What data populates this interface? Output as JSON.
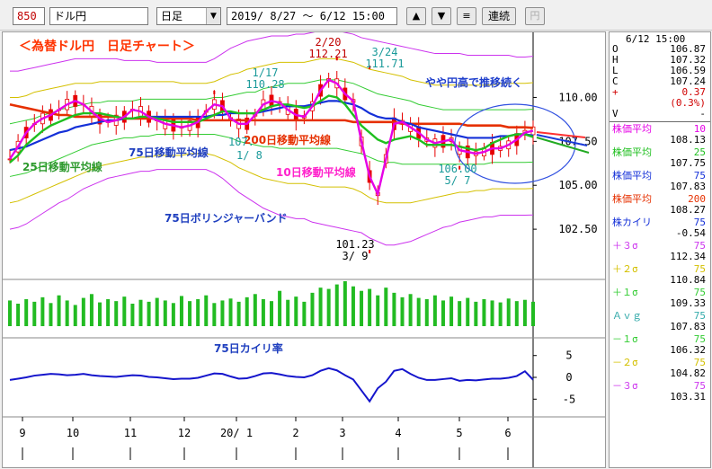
{
  "toolbar": {
    "code": "850",
    "name": "ドル円",
    "period": "日足",
    "period_dropdown_glyph": "▼",
    "range": "2019/ 8/27 ～  6/12 15:00",
    "btn_up": "▲",
    "btn_down": "▼",
    "btn_menu": "≡",
    "btn_link": "連続",
    "btn_yen": "円"
  },
  "chart": {
    "title": "＜為替ドル円　日足チャート＞",
    "annotations": {
      "ma25": "25日移動平均線",
      "ma75": "75日移動平均線",
      "ma200": "200日移動平均線",
      "ma10": "10日移動平均線",
      "bollinger": "75日ボリンジャーバンド",
      "deviation": "75日カイリ率",
      "note": "やや円高で推移続く"
    },
    "peaks": {
      "a_date": "1/17",
      "a_value": "110.28",
      "b_date": "2/20",
      "b_value": "112.21",
      "c_date": "3/24",
      "c_value": "111.71",
      "d_value": "106.00",
      "d_date": "5/ 7",
      "e_value": "101.23",
      "e_date": "3/ 9",
      "f_value": "107.",
      "f_date": "1/ 8"
    },
    "colors": {
      "candle": "#e60000",
      "ma10": "#e600e6",
      "ma25": "#1fbf1f",
      "ma75": "#1430d8",
      "ma200": "#e63000",
      "bb3": "#cc33ee",
      "bb2": "#d4c000",
      "bb1": "#33cc33",
      "volume": "#22bb22",
      "deviation": "#1515cc",
      "title": "#ff3300",
      "label_green": "#2e9a2e",
      "label_blue": "#1f3fbf",
      "label_pink": "#ff22cc",
      "label_note": "#1f3fcc"
    }
  },
  "chart_data": {
    "type": "line",
    "x_labels": [
      "9",
      "10",
      "11",
      "12",
      "20/ 1",
      "2",
      "3",
      "4",
      "5",
      "6"
    ],
    "price_axis": {
      "ticks": [
        "110.00",
        "107.50",
        "105.00",
        "102.50"
      ],
      "range": [
        100.0,
        113.5
      ]
    },
    "series": [
      {
        "name": "株価平均 10",
        "values": [
          106.5,
          107.2,
          108.0,
          108.5,
          108.8,
          109.0,
          109.3,
          109.6,
          109.8,
          109.6,
          109.2,
          108.8,
          108.6,
          108.7,
          108.9,
          109.3,
          109.2,
          108.9,
          108.7,
          108.5,
          108.4,
          108.3,
          108.4,
          108.6,
          109.2,
          109.6,
          109.5,
          108.8,
          108.5,
          108.5,
          109.0,
          109.6,
          109.8,
          109.7,
          109.3,
          109.0,
          108.9,
          109.5,
          110.4,
          111.0,
          110.8,
          110.2,
          109.8,
          107.5,
          105.5,
          104.5,
          106.5,
          108.5,
          108.6,
          108.3,
          108.0,
          107.6,
          107.4,
          107.5,
          107.6,
          107.0,
          106.9,
          106.8,
          106.9,
          107.1,
          107.1,
          107.3,
          107.6,
          108.0,
          108.1
        ]
      },
      {
        "name": "株価平均 25",
        "values": [
          106.3,
          106.7,
          107.3,
          107.7,
          108.1,
          108.4,
          108.6,
          108.8,
          109.0,
          109.1,
          109.1,
          109.1,
          109.0,
          108.9,
          108.8,
          108.8,
          108.9,
          108.9,
          108.8,
          108.7,
          108.6,
          108.6,
          108.6,
          108.6,
          108.8,
          109.0,
          109.2,
          109.2,
          109.1,
          109.1,
          109.1,
          109.3,
          109.5,
          109.6,
          109.6,
          109.5,
          109.4,
          109.5,
          109.8,
          110.1,
          110.0,
          109.6,
          109.0,
          108.4,
          108.0,
          107.6,
          107.4,
          107.6,
          107.7,
          107.8,
          107.6,
          107.3,
          107.3,
          107.3,
          107.3,
          107.2,
          107.1,
          107.0,
          107.1,
          107.4,
          107.6,
          107.8,
          107.9,
          107.9,
          107.75
        ]
      },
      {
        "name": "株価平均 75",
        "values": [
          107.0,
          107.1,
          107.2,
          107.4,
          107.6,
          107.8,
          108.0,
          108.1,
          108.3,
          108.4,
          108.5,
          108.6,
          108.7,
          108.7,
          108.8,
          108.8,
          108.9,
          108.9,
          108.9,
          108.9,
          108.9,
          108.9,
          108.9,
          108.9,
          108.9,
          109.0,
          109.0,
          109.1,
          109.1,
          109.1,
          109.1,
          109.2,
          109.3,
          109.4,
          109.5,
          109.5,
          109.5,
          109.6,
          109.7,
          109.8,
          109.8,
          109.7,
          109.6,
          109.4,
          109.1,
          108.9,
          108.8,
          108.8,
          108.6,
          108.5,
          108.3,
          108.2,
          108.1,
          108.0,
          107.9,
          107.8,
          107.7,
          107.7,
          107.7,
          107.7,
          107.8,
          107.8,
          107.9,
          107.9,
          107.83
        ]
      },
      {
        "name": "株価平均 200",
        "values": [
          109.6,
          109.5,
          109.4,
          109.3,
          109.2,
          109.1,
          109.0,
          109.0,
          108.9,
          108.9,
          108.9,
          108.9,
          108.9,
          108.9,
          108.8,
          108.8,
          108.8,
          108.8,
          108.8,
          108.8,
          108.8,
          108.8,
          108.8,
          108.7,
          108.7,
          108.7,
          108.7,
          108.7,
          108.7,
          108.7,
          108.7,
          108.7,
          108.7,
          108.7,
          108.7,
          108.7,
          108.7,
          108.7,
          108.7,
          108.7,
          108.7,
          108.7,
          108.6,
          108.6,
          108.6,
          108.6,
          108.6,
          108.6,
          108.5,
          108.5,
          108.5,
          108.5,
          108.5,
          108.5,
          108.5,
          108.5,
          108.4,
          108.4,
          108.4,
          108.4,
          108.4,
          108.3,
          108.3,
          108.3,
          108.27
        ]
      },
      {
        "name": "+3σ 75",
        "values": [
          111.5,
          111.5,
          111.6,
          111.7,
          111.8,
          111.9,
          112.0,
          112.1,
          112.2,
          112.2,
          112.2,
          112.2,
          112.2,
          112.2,
          112.1,
          112.1,
          112.1,
          112.1,
          112.0,
          112.0,
          112.0,
          112.0,
          112.0,
          112.0,
          112.0,
          112.2,
          112.5,
          112.8,
          113.0,
          113.2,
          113.3,
          113.4,
          113.5,
          113.5,
          113.5,
          113.6,
          113.6,
          113.7,
          113.8,
          113.8,
          113.8,
          113.7,
          113.6,
          113.4,
          113.3,
          113.2,
          113.1,
          113.0,
          112.9,
          112.8,
          112.7,
          112.6,
          112.5,
          112.5,
          112.5,
          112.5,
          112.4,
          112.4,
          112.4,
          112.4,
          112.4,
          112.4,
          112.3,
          112.3,
          112.34
        ]
      },
      {
        "name": "+2σ 75",
        "values": [
          110.0,
          110.0,
          110.1,
          110.3,
          110.4,
          110.5,
          110.6,
          110.7,
          110.8,
          110.8,
          110.8,
          110.9,
          110.9,
          110.9,
          110.9,
          110.9,
          110.9,
          110.9,
          110.9,
          110.9,
          110.9,
          110.8,
          110.8,
          110.8,
          110.8,
          110.9,
          111.1,
          111.3,
          111.4,
          111.6,
          111.7,
          111.8,
          111.9,
          112.0,
          112.0,
          112.0,
          112.0,
          112.1,
          112.2,
          112.2,
          112.2,
          112.1,
          112.0,
          111.8,
          111.6,
          111.5,
          111.4,
          111.3,
          111.2,
          111.0,
          110.9,
          110.8,
          110.7,
          110.7,
          110.7,
          110.7,
          110.7,
          110.7,
          110.7,
          110.7,
          110.8,
          110.8,
          110.8,
          110.8,
          110.84
        ]
      },
      {
        "name": "+1σ 75",
        "values": [
          108.5,
          108.6,
          108.7,
          108.8,
          109.0,
          109.1,
          109.3,
          109.4,
          109.5,
          109.6,
          109.7,
          109.7,
          109.8,
          109.8,
          109.8,
          109.8,
          109.9,
          109.9,
          109.9,
          109.9,
          109.9,
          109.9,
          109.9,
          109.9,
          109.9,
          110.0,
          110.0,
          110.1,
          110.2,
          110.3,
          110.3,
          110.5,
          110.6,
          110.7,
          110.8,
          110.8,
          110.8,
          110.9,
          111.0,
          111.0,
          111.0,
          110.9,
          110.8,
          110.6,
          110.4,
          110.2,
          110.1,
          110.0,
          109.9,
          109.8,
          109.6,
          109.5,
          109.4,
          109.3,
          109.3,
          109.3,
          109.3,
          109.3,
          109.3,
          109.3,
          109.3,
          109.3,
          109.3,
          109.3,
          109.33
        ]
      },
      {
        "name": "-1σ 75",
        "values": [
          105.5,
          105.6,
          105.7,
          105.9,
          106.1,
          106.3,
          106.5,
          106.7,
          106.9,
          107.1,
          107.3,
          107.4,
          107.5,
          107.6,
          107.7,
          107.7,
          107.8,
          107.8,
          107.9,
          107.9,
          107.9,
          107.9,
          107.9,
          107.9,
          107.9,
          107.9,
          107.8,
          107.7,
          107.5,
          107.4,
          107.3,
          107.2,
          107.2,
          107.1,
          107.1,
          107.1,
          107.1,
          107.1,
          107.1,
          107.1,
          107.1,
          107.0,
          106.9,
          106.8,
          106.6,
          106.4,
          106.3,
          106.3,
          106.2,
          106.2,
          106.2,
          106.2,
          106.2,
          106.2,
          106.2,
          106.2,
          106.2,
          106.2,
          106.2,
          106.3,
          106.3,
          106.3,
          106.3,
          106.3,
          106.32
        ]
      },
      {
        "name": "-2σ 75",
        "values": [
          104.0,
          104.1,
          104.3,
          104.5,
          104.7,
          104.9,
          105.1,
          105.3,
          105.5,
          105.7,
          105.9,
          106.1,
          106.2,
          106.3,
          106.4,
          106.5,
          106.6,
          106.6,
          106.7,
          106.7,
          106.7,
          106.7,
          106.8,
          106.8,
          106.8,
          106.7,
          106.5,
          106.3,
          106.0,
          105.8,
          105.6,
          105.4,
          105.3,
          105.2,
          105.1,
          105.1,
          105.1,
          105.0,
          104.9,
          104.9,
          104.9,
          104.9,
          104.8,
          104.6,
          104.3,
          104.1,
          104.0,
          104.0,
          104.0,
          104.0,
          104.1,
          104.2,
          104.3,
          104.4,
          104.5,
          104.6,
          104.6,
          104.7,
          104.7,
          104.8,
          104.8,
          104.8,
          104.8,
          104.8,
          104.82
        ]
      },
      {
        "name": "-3σ 75",
        "values": [
          102.5,
          102.6,
          102.8,
          103.1,
          103.4,
          103.7,
          104.0,
          104.2,
          104.5,
          104.8,
          105.0,
          105.2,
          105.4,
          105.5,
          105.6,
          105.7,
          105.8,
          105.8,
          105.9,
          105.9,
          105.9,
          105.9,
          105.9,
          105.9,
          105.9,
          105.7,
          105.4,
          105.0,
          104.6,
          104.3,
          104.0,
          103.7,
          103.5,
          103.3,
          103.2,
          103.1,
          103.1,
          102.9,
          102.8,
          102.7,
          102.6,
          102.5,
          102.4,
          102.3,
          102.0,
          101.8,
          101.6,
          101.6,
          101.7,
          101.8,
          102.0,
          102.2,
          102.4,
          102.6,
          102.7,
          102.9,
          103.0,
          103.1,
          103.2,
          103.2,
          103.3,
          103.3,
          103.3,
          103.3,
          103.31
        ]
      },
      {
        "name": "株カイリ 75",
        "axis": "deviation",
        "values": [
          -0.6,
          -0.3,
          0.0,
          0.4,
          0.6,
          0.8,
          0.7,
          0.5,
          0.6,
          0.8,
          0.5,
          0.3,
          0.2,
          0.1,
          0.3,
          0.5,
          0.4,
          0.1,
          0.0,
          -0.2,
          -0.4,
          -0.3,
          -0.3,
          -0.1,
          0.4,
          0.9,
          0.8,
          0.2,
          -0.3,
          -0.2,
          0.3,
          0.9,
          1.0,
          0.7,
          0.3,
          0.1,
          0.0,
          0.5,
          1.5,
          2.1,
          1.6,
          0.5,
          -0.5,
          -3.0,
          -5.5,
          -2.5,
          -1.0,
          1.5,
          1.9,
          0.8,
          -0.1,
          -0.6,
          -0.6,
          -0.4,
          -0.2,
          -0.8,
          -0.6,
          -0.7,
          -0.5,
          -0.3,
          -0.3,
          -0.1,
          0.3,
          1.4,
          -0.54
        ]
      }
    ],
    "deviation_axis": {
      "ticks": [
        "5",
        "0",
        "-5"
      ],
      "range": [
        -7,
        7
      ]
    },
    "price_markers": [
      {
        "label": "2/20 112.21",
        "value": 112.21
      },
      {
        "label": "3/24 111.71",
        "value": 111.71
      },
      {
        "label": "3/ 9 101.23",
        "value": 101.23
      },
      {
        "label": "5/ 7 106.00",
        "value": 106.0
      },
      {
        "label": "1/17 110.28",
        "value": 110.28
      }
    ],
    "volume_values": [
      40,
      35,
      42,
      38,
      45,
      36,
      48,
      40,
      33,
      44,
      50,
      37,
      42,
      39,
      46,
      35,
      41,
      38,
      44,
      40,
      36,
      47,
      39,
      42,
      48,
      36,
      40,
      43,
      38,
      45,
      50,
      42,
      39,
      55,
      41,
      46,
      38,
      52,
      60,
      58,
      65,
      70,
      62,
      55,
      58,
      48,
      60,
      52,
      45,
      50,
      44,
      42,
      48,
      40,
      46,
      39,
      44,
      38,
      42,
      40,
      37,
      43,
      39,
      41,
      38
    ]
  },
  "sidebar": {
    "datetime": "6/12 15:00",
    "ohlc": [
      {
        "k": "O",
        "v": "106.87"
      },
      {
        "k": "H",
        "v": "107.32"
      },
      {
        "k": "L",
        "v": "106.59"
      },
      {
        "k": "C",
        "v": "107.24"
      }
    ],
    "change_sign": "+",
    "change": "0.37",
    "change_pct": "(0.3%)",
    "vol_label": "V",
    "vol_value": "-",
    "indicators": [
      {
        "label": "株価平均",
        "period": "10",
        "value": "108.13",
        "color": "#e600e6"
      },
      {
        "label": "株価平均",
        "period": "25",
        "value": "107.75",
        "color": "#1fbf1f"
      },
      {
        "label": "株価平均",
        "period": "75",
        "value": "107.83",
        "color": "#1430d8"
      },
      {
        "label": "株価平均",
        "period": "200",
        "value": "108.27",
        "color": "#e63000"
      },
      {
        "label": "株カイリ",
        "period": "75",
        "value": "-0.54",
        "color": "#1430d8"
      },
      {
        "label": "＋３σ",
        "period": "75",
        "value": "112.34",
        "color": "#cc33ee"
      },
      {
        "label": "＋２σ",
        "period": "75",
        "value": "110.84",
        "color": "#d4c000"
      },
      {
        "label": "＋１σ",
        "period": "75",
        "value": "109.33",
        "color": "#33cc33"
      },
      {
        "label": "Ａｖｇ",
        "period": "75",
        "value": "107.83",
        "color": "#33aaaa"
      },
      {
        "label": "－１σ",
        "period": "75",
        "value": "106.32",
        "color": "#33cc33"
      },
      {
        "label": "－２σ",
        "period": "75",
        "value": "104.82",
        "color": "#d4c000"
      },
      {
        "label": "－３σ",
        "period": "75",
        "value": "103.31",
        "color": "#cc33ee"
      }
    ]
  }
}
